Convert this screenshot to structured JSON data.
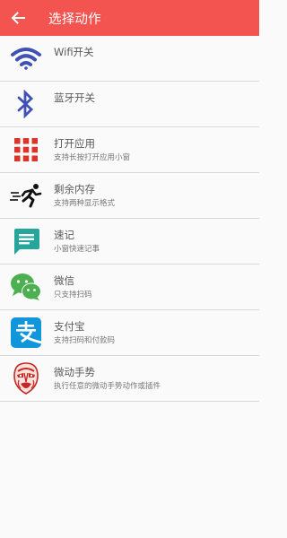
{
  "app_bar": {
    "title": "选择动作",
    "back_icon": "arrow-left-icon",
    "color": "#f4544f"
  },
  "actions": [
    {
      "name": "wifi",
      "label": "Wifi开关",
      "subtitle": "",
      "icon": "wifi-icon",
      "icon_color": "#3f51b5"
    },
    {
      "name": "bluetooth",
      "label": "蓝牙开关",
      "subtitle": "",
      "icon": "bluetooth-icon",
      "icon_color": "#3f51b5"
    },
    {
      "name": "open-app",
      "label": "打开应用",
      "subtitle": "支持长按打开应用小窗",
      "icon": "app-grid-icon",
      "icon_color": "#d9352b"
    },
    {
      "name": "free-memory",
      "label": "剩余内存",
      "subtitle": "支持两种显示格式",
      "icon": "running-man-icon",
      "icon_color": "#111111"
    },
    {
      "name": "quick-note",
      "label": "速记",
      "subtitle": "小窗快速记事",
      "icon": "note-icon",
      "icon_color": "#26a69a"
    },
    {
      "name": "wechat",
      "label": "微信",
      "subtitle": "只支持扫码",
      "icon": "wechat-icon",
      "icon_color": "#4caf50"
    },
    {
      "name": "alipay",
      "label": "支付宝",
      "subtitle": "支持扫码和付款码",
      "icon": "alipay-icon",
      "icon_color": "#1296db"
    },
    {
      "name": "gesture",
      "label": "微动手势",
      "subtitle": "执行任意的微动手势动作或插件",
      "icon": "opera-mask-icon",
      "icon_color": "#e53935"
    }
  ]
}
